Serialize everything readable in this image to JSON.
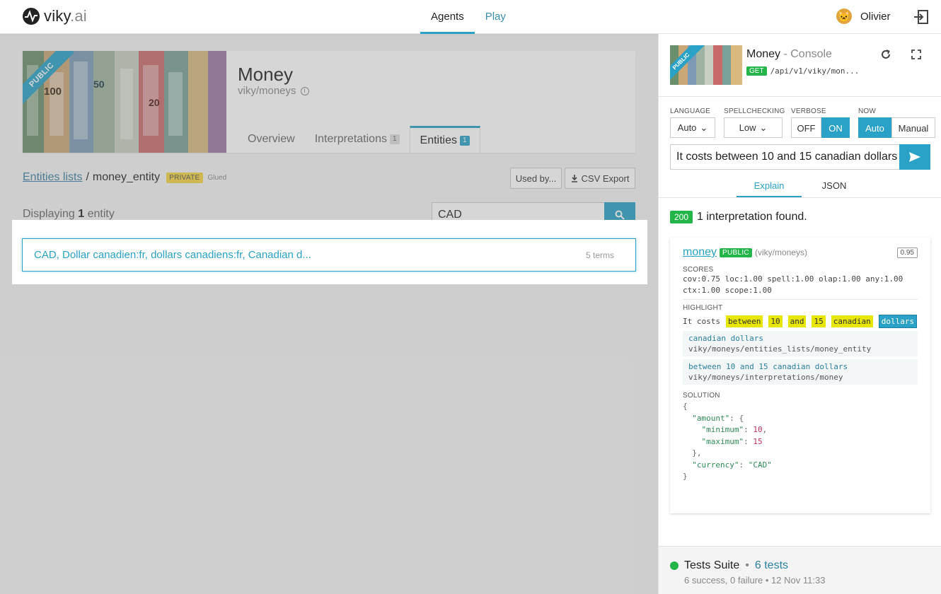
{
  "header": {
    "logo_text": "viky",
    "logo_suffix": ".ai",
    "nav": [
      {
        "label": "Agents",
        "active": true
      },
      {
        "label": "Play",
        "active": false
      }
    ],
    "user_name": "Olivier",
    "avatar_icon": "cat-avatar-icon",
    "logout_icon": "logout-icon"
  },
  "agent": {
    "name": "Money",
    "slug": "viky/moneys",
    "visibility": "PUBLIC",
    "tabs": [
      {
        "label": "Overview",
        "count": null
      },
      {
        "label": "Interpretations",
        "count": "1"
      },
      {
        "label": "Entities",
        "count": "1",
        "active": true
      }
    ]
  },
  "breadcrumb": {
    "parent_link": "Entities lists",
    "separator": "/",
    "current": "money_entity",
    "private_badge": "PRIVATE",
    "glued": "Glued"
  },
  "actions": {
    "used_by": "Used by...",
    "csv_export": "CSV Export"
  },
  "listing": {
    "displaying_prefix": "Displaying",
    "count": "1",
    "displaying_suffix": "entity",
    "search_value": "CAD",
    "entities": [
      {
        "terms": "CAD, Dollar canadien:fr, dollars canadiens:fr, Canadian d...",
        "count": "5 terms"
      }
    ]
  },
  "console": {
    "title": "Money",
    "title_suffix": " - Console",
    "visibility": "PUBLIC",
    "method": "GET",
    "endpoint": "/api/v1/viky/mon...",
    "options": {
      "language_label": "LANGUAGE",
      "language_value": "Auto",
      "spellcheck_label": "SPELLCHECKING",
      "spellcheck_value": "Low",
      "verbose_label": "VERBOSE",
      "verbose_off": "OFF",
      "verbose_on": "ON",
      "now_label": "NOW",
      "now_auto": "Auto",
      "now_manual": "Manual"
    },
    "query": "It costs between 10 and 15 canadian dollars",
    "tabs": [
      {
        "label": "Explain",
        "active": true
      },
      {
        "label": "JSON",
        "active": false
      }
    ],
    "status_code": "200",
    "status_text": "1 interpretation found.",
    "interpretation": {
      "name": "money",
      "visibility": "PUBLIC",
      "slug": "(viky/moneys)",
      "score": "0.95",
      "scores_label": "SCORES",
      "scores_line1": "cov:0.75 loc:1.00 spell:1.00 olap:1.00 any:1.00",
      "scores_line2": "ctx:1.00 scope:1.00",
      "highlight_label": "HIGHLIGHT",
      "highlight_plain": "It costs",
      "highlight_tokens": [
        "between",
        "10",
        "and",
        "15",
        "canadian"
      ],
      "highlight_last": "dollars",
      "match1_text": "canadian dollars",
      "match1_path": "viky/moneys/entities_lists/money_entity",
      "match2_text": "between 10 and 15 canadian dollars",
      "match2_path": "viky/moneys/interpretations/money",
      "solution_label": "SOLUTION",
      "solution": {
        "open": "{",
        "amount_key": "\"amount\"",
        "amount_open": ": {",
        "min_key": "\"minimum\"",
        "min_val": "10",
        "max_key": "\"maximum\"",
        "max_val": "15",
        "amount_close": "},",
        "currency_key": "\"currency\"",
        "currency_val": "\"CAD\"",
        "close": "}"
      }
    },
    "tests": {
      "title": "Tests Suite",
      "sep": "•",
      "count": "6 tests",
      "summary": "6 success, 0 failure • 12 Nov 11:33"
    }
  },
  "colors": {
    "accent": "#2aa1c6",
    "success": "#23b44a",
    "private": "#f5d542",
    "highlight": "#e6e600"
  }
}
